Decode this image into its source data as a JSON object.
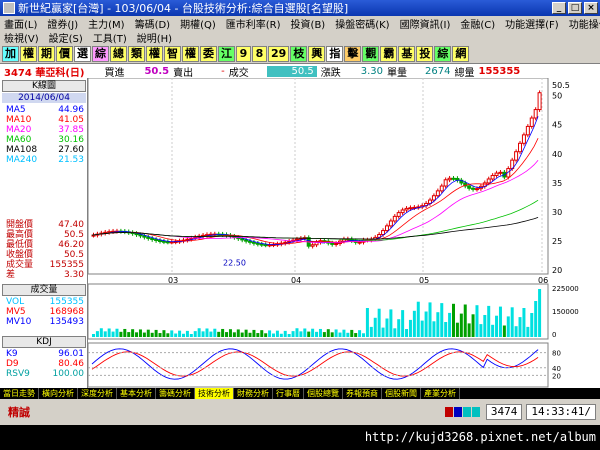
{
  "window": {
    "title": "新世紀贏家[台灣] - 103/06/04 - 台股技術分析:綜合自選股[名望股]"
  },
  "menu": {
    "row1": [
      "畫面(L)",
      "證券(J)",
      "主力(M)",
      "籌碼(D)",
      "期權(Q)",
      "匯市利率(R)",
      "投資(B)",
      "操盤密碼(K)",
      "國際資訊(I)",
      "金融(C)",
      "功能選擇(F)",
      "功能操作(F)"
    ],
    "row2": [
      "檢視(V)",
      "設定(S)",
      "工具(T)",
      "說明(H)"
    ]
  },
  "toolbar": [
    "加",
    "權",
    "期",
    "價",
    "選",
    "綜",
    "總",
    "類",
    "權",
    "智",
    "權",
    "委",
    "江",
    "9",
    "8",
    "29",
    "枝",
    "興",
    "指",
    "擊",
    "觀",
    "霸",
    "基",
    "投",
    "綜",
    "網"
  ],
  "quote": {
    "code_name": "3474 華亞科(日)",
    "buy_label": "買進",
    "buy": "50.5",
    "sell_label": "賣出",
    "sell": "-",
    "deal_label": "成交",
    "deal": "50.5",
    "chg_label": "漲跌",
    "chg": "3.30",
    "vol_label": "單量",
    "vol": "2674",
    "total_label": "總量",
    "total": "155355"
  },
  "side": {
    "kline_label": "K線圖",
    "date": "2014/06/04",
    "ma": [
      {
        "k": "MA5",
        "v": "44.96",
        "c": "#0000ff"
      },
      {
        "k": "MA10",
        "v": "41.05",
        "c": "#ff0000"
      },
      {
        "k": "MA20",
        "v": "37.85",
        "c": "#ff00ff"
      },
      {
        "k": "MA60",
        "v": "30.16",
        "c": "#00c000"
      },
      {
        "k": "MA108",
        "v": "27.60",
        "c": "#000000"
      },
      {
        "k": "MA240",
        "v": "21.53",
        "c": "#00c0ff"
      }
    ],
    "prices": [
      {
        "k": "開盤價",
        "v": "47.40"
      },
      {
        "k": "最高價",
        "v": "50.5"
      },
      {
        "k": "最低價",
        "v": "46.20"
      },
      {
        "k": "收盤價",
        "v": "50.5"
      },
      {
        "k": "成交量",
        "v": "155355"
      },
      {
        "k": "差",
        "v": "3.30"
      }
    ],
    "vol_label": "成交量",
    "vols": [
      {
        "k": "VOL",
        "v": "155355",
        "c": "#00c0ff"
      },
      {
        "k": "MV5",
        "v": "168968",
        "c": "#ff0000"
      },
      {
        "k": "MV10",
        "v": "135493",
        "c": "#0000ff"
      }
    ],
    "kd_label": "KDJ",
    "kds": [
      {
        "k": "K9",
        "v": "96.01",
        "c": "#0000ff"
      },
      {
        "k": "D9",
        "v": "80.46",
        "c": "#ff0000"
      },
      {
        "k": "RSV9",
        "v": "100.00",
        "c": "#00a0a0"
      }
    ]
  },
  "chart": {
    "price_ticks": [
      "50.5",
      "50",
      "45",
      "40",
      "35",
      "30",
      "25",
      "20"
    ],
    "min_label": "22.50",
    "months": [
      "03",
      "04",
      "05",
      "06"
    ],
    "vol_ticks": [
      "225000",
      "150000",
      "0"
    ],
    "kd_ticks": [
      "80",
      "40",
      "20"
    ]
  },
  "bottom_tabs": [
    "當日走勢",
    "橫向分析",
    "深度分析",
    "基本分析",
    "籌碼分析",
    "技術分析",
    "財務分析",
    "行事曆",
    "個股總覽",
    "券報預商",
    "個股新聞",
    "產業分析"
  ],
  "status": {
    "label": "精誠",
    "code": "3474",
    "clock": "14:33:41/"
  },
  "watermark": "http://kujd3268.pixnet.net/album"
}
